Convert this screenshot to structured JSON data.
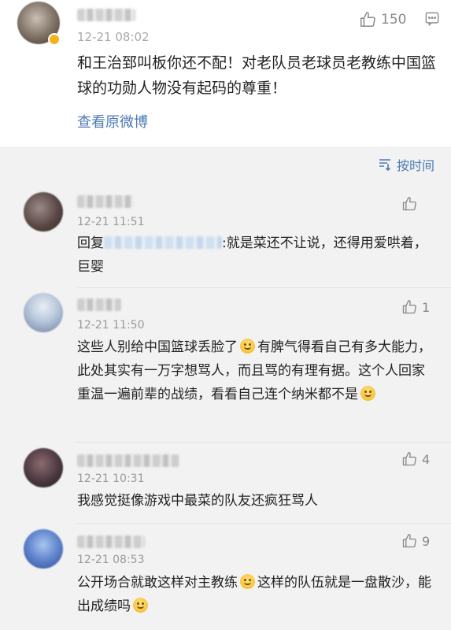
{
  "main_comment": {
    "time": "12-21 08:02",
    "likes": "150",
    "text": "和王治郅叫板你还不配！对老队员老球员老教练中国篮球的功勋人物没有起码的尊重！",
    "view_original": "查看原微博"
  },
  "sort_label": "按时间",
  "comments": [
    {
      "time": "12-21 11:51",
      "likes": "",
      "reply_prefix": "回复",
      "text": ":就是菜还不让说，还得用爱哄着，巨婴"
    },
    {
      "time": "12-21 11:50",
      "likes": "1",
      "text_a": "这些人别给中国篮球丢脸了",
      "text_b": "有脾气得看自己有多大能力，此处其实有一万字想骂人，而且骂的有理有据。这个人回家重温一遍前辈的战绩，看看自己连个纳米都不是",
      "emoji": "smile-emoji"
    },
    {
      "time": "12-21 10:31",
      "likes": "4",
      "text": "我感觉挺像游戏中最菜的队友还疯狂骂人"
    },
    {
      "time": "12-21 08:53",
      "likes": "9",
      "text_a": "公开场合就敢这样对主教练",
      "text_b": "这样的队伍就是一盘散沙，能出成绩吗"
    }
  ],
  "icons": {
    "like": "thumbs-up-icon",
    "more": "more-icon",
    "sort": "sort-icon"
  }
}
